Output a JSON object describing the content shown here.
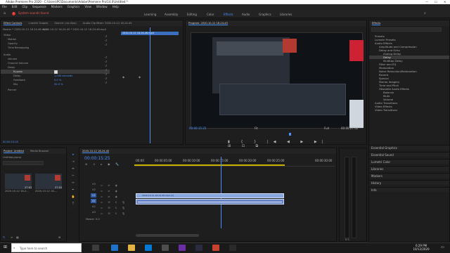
{
  "window": {
    "title": "Adobe Premiere Pro 2020 - C:\\Users\\PC\\Documents\\Adobe\\Premiere Pro\\14.0\\Untitled *"
  },
  "menu": [
    "File",
    "Edit",
    "Clip",
    "Sequence",
    "Markers",
    "Graphics",
    "View",
    "Window",
    "Help"
  ],
  "alert": "System sounds found",
  "workspaces": [
    "Learning",
    "Assembly",
    "Editing",
    "Color",
    "Effects",
    "Audio",
    "Graphics",
    "Libraries"
  ],
  "effect_controls": {
    "tabs": [
      "Effect Controls",
      "Lumetri Scopes",
      "Source: (no clips)",
      "Audio Clip Mixer: 2020-10-12 18-24-45"
    ],
    "clip": "Master * 2020-10-12 18-24-46.mp4",
    "seq": "2020-10-12 18-24-45 * 2020-10-12 18-24-46.mp4",
    "mini_clip": "2020-10-12 18-24-46.mp4",
    "timecode": "00:00:15:25",
    "rows": [
      "Video",
      "Motion",
      "Opacity",
      "Time Remapping",
      "Audio",
      "Volume",
      "Channel Volume",
      "Delay",
      "Bypass",
      "Delay",
      "Feedback",
      "Mix",
      "Panner"
    ],
    "delay_val": "1.000 seconds",
    "feedback_val": "0.0 %",
    "mix_val": "50.0 %"
  },
  "program": {
    "title": "Program: 2020-10-12 18-24-45",
    "timecode": "00:00:15:25",
    "fit": "Fit",
    "quality": "Full",
    "duration": "00:00:27:02"
  },
  "effects_panel": {
    "title": "Effects",
    "items": [
      "Presets",
      "Lumetri Presets",
      "Audio Effects",
      "Amplitude and Compression",
      "Delay and Echo",
      "Analog Delay",
      "Delay",
      "Multitap Delay",
      "Filter and EQ",
      "Modulation",
      "Noise Reduction/Restoration",
      "Reverb",
      "Special",
      "Stereo Imagery",
      "Time and Pitch",
      "Obsolete Audio Effects",
      "Balance",
      "Mute",
      "Volume",
      "Audio Transitions",
      "Video Effects",
      "Video Transitions"
    ],
    "sections": [
      "Essential Graphics",
      "Essential Sound",
      "Lumetri Color",
      "Libraries",
      "Markers",
      "History",
      "Info"
    ]
  },
  "project": {
    "tabs": [
      "Project: Untitled",
      "Media Browser"
    ],
    "name": "Untitled.prproj",
    "items": [
      "2020-10-12 18-2...",
      "2020-10-12 18-..."
    ],
    "durs": [
      "27:02",
      "27:02"
    ]
  },
  "timeline": {
    "tab": "2020-10-12 18-24-45",
    "timecode": "00:00:15:25",
    "ruler": [
      ":00:00",
      "00:00:05:00",
      "00:00:10:00",
      "00:00:15:00",
      "00:00:20:00",
      "00:00:25:00",
      "00:00:30:00"
    ],
    "tracks": [
      "V3",
      "V2",
      "V1",
      "A1",
      "A2",
      "A3"
    ],
    "clip_label": "2020-10-12 18-24-46.mp4 [V]",
    "master_label": "Master",
    "master_val": "0.0"
  },
  "taskbar": {
    "search": "Type here to search",
    "time": "6:29 PM",
    "date": "10/12/2020"
  },
  "colors": {
    "accent": "#4a90ff",
    "clip_video": "#8aa8e0",
    "clip_audio": "#6a84c8"
  }
}
